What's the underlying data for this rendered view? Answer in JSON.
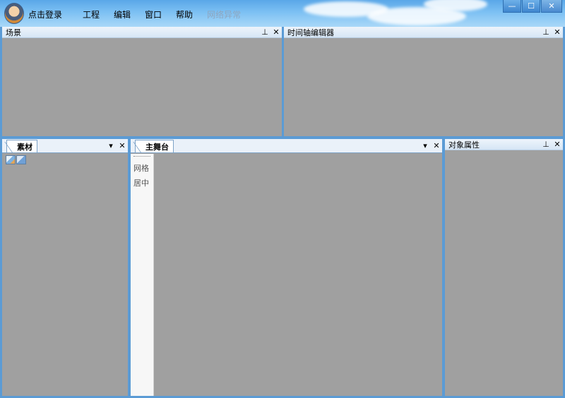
{
  "titlebar": {
    "login_label": "点击登录",
    "menu": [
      {
        "label": "工程",
        "enabled": true
      },
      {
        "label": "编辑",
        "enabled": true
      },
      {
        "label": "窗口",
        "enabled": true
      },
      {
        "label": "帮助",
        "enabled": true
      },
      {
        "label": "网络异常",
        "enabled": false
      }
    ],
    "window_controls": {
      "minimize": "—",
      "maximize": "☐",
      "close": "✕"
    }
  },
  "panels": {
    "scene": {
      "title": "场景",
      "pin": "⊥",
      "close": "✕"
    },
    "timeline": {
      "title": "时间轴编辑器",
      "pin": "⊥",
      "close": "✕"
    },
    "assets": {
      "tab": "素材",
      "menu": "▾",
      "close": "✕"
    },
    "stage": {
      "tab": "主舞台",
      "menu": "▾",
      "close": "✕",
      "side_buttons": [
        "网格",
        "居中"
      ]
    },
    "properties": {
      "title": "对象属性",
      "pin": "⊥",
      "close": "✕"
    }
  },
  "colors": {
    "frame": "#5b9bd5",
    "panel_bg": "#a0a0a0",
    "header_bg": "#dde9f6",
    "disabled_menu": "#8ea6bf"
  }
}
